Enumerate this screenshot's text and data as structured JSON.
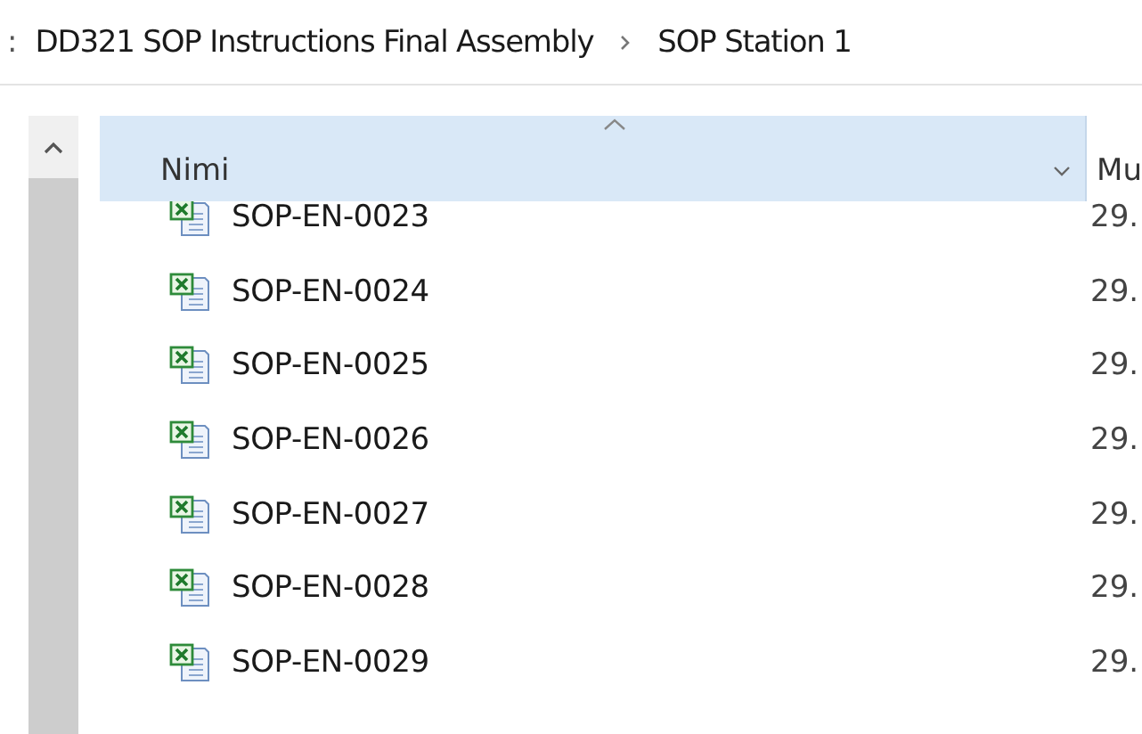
{
  "breadcrumb": {
    "lead": ":",
    "items": [
      {
        "label": "DD321 SOP Instructions Final Assembly"
      },
      {
        "label": "SOP Station 1"
      }
    ]
  },
  "columns": [
    {
      "label": "Nimi",
      "sorted": true
    },
    {
      "label": "Mu",
      "sorted": false
    }
  ],
  "rows": [
    {
      "name": "SOP-EN-0023",
      "date": "29."
    },
    {
      "name": "SOP-EN-0024",
      "date": "29."
    },
    {
      "name": "SOP-EN-0025",
      "date": "29."
    },
    {
      "name": "SOP-EN-0026",
      "date": "29."
    },
    {
      "name": "SOP-EN-0027",
      "date": "29."
    },
    {
      "name": "SOP-EN-0028",
      "date": "29."
    },
    {
      "name": "SOP-EN-0029",
      "date": "29."
    }
  ]
}
